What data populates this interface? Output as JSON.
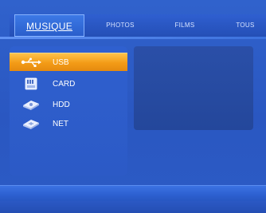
{
  "tabs": [
    {
      "label": "MUSIQUE",
      "active": true
    },
    {
      "label": "PHOTOS",
      "active": false
    },
    {
      "label": "FILMS",
      "active": false
    },
    {
      "label": "TOUS",
      "active": false
    }
  ],
  "menu": [
    {
      "label": "USB",
      "icon": "usb-icon",
      "selected": true
    },
    {
      "label": "CARD",
      "icon": "memory-card-icon",
      "selected": false
    },
    {
      "label": "HDD",
      "icon": "hard-drive-icon",
      "selected": false
    },
    {
      "label": "NET",
      "icon": "network-icon",
      "selected": false
    }
  ],
  "colors": {
    "background": "#2c5bc8",
    "selected_item": "#f39b16",
    "preview_panel": "#2a4fa8"
  }
}
